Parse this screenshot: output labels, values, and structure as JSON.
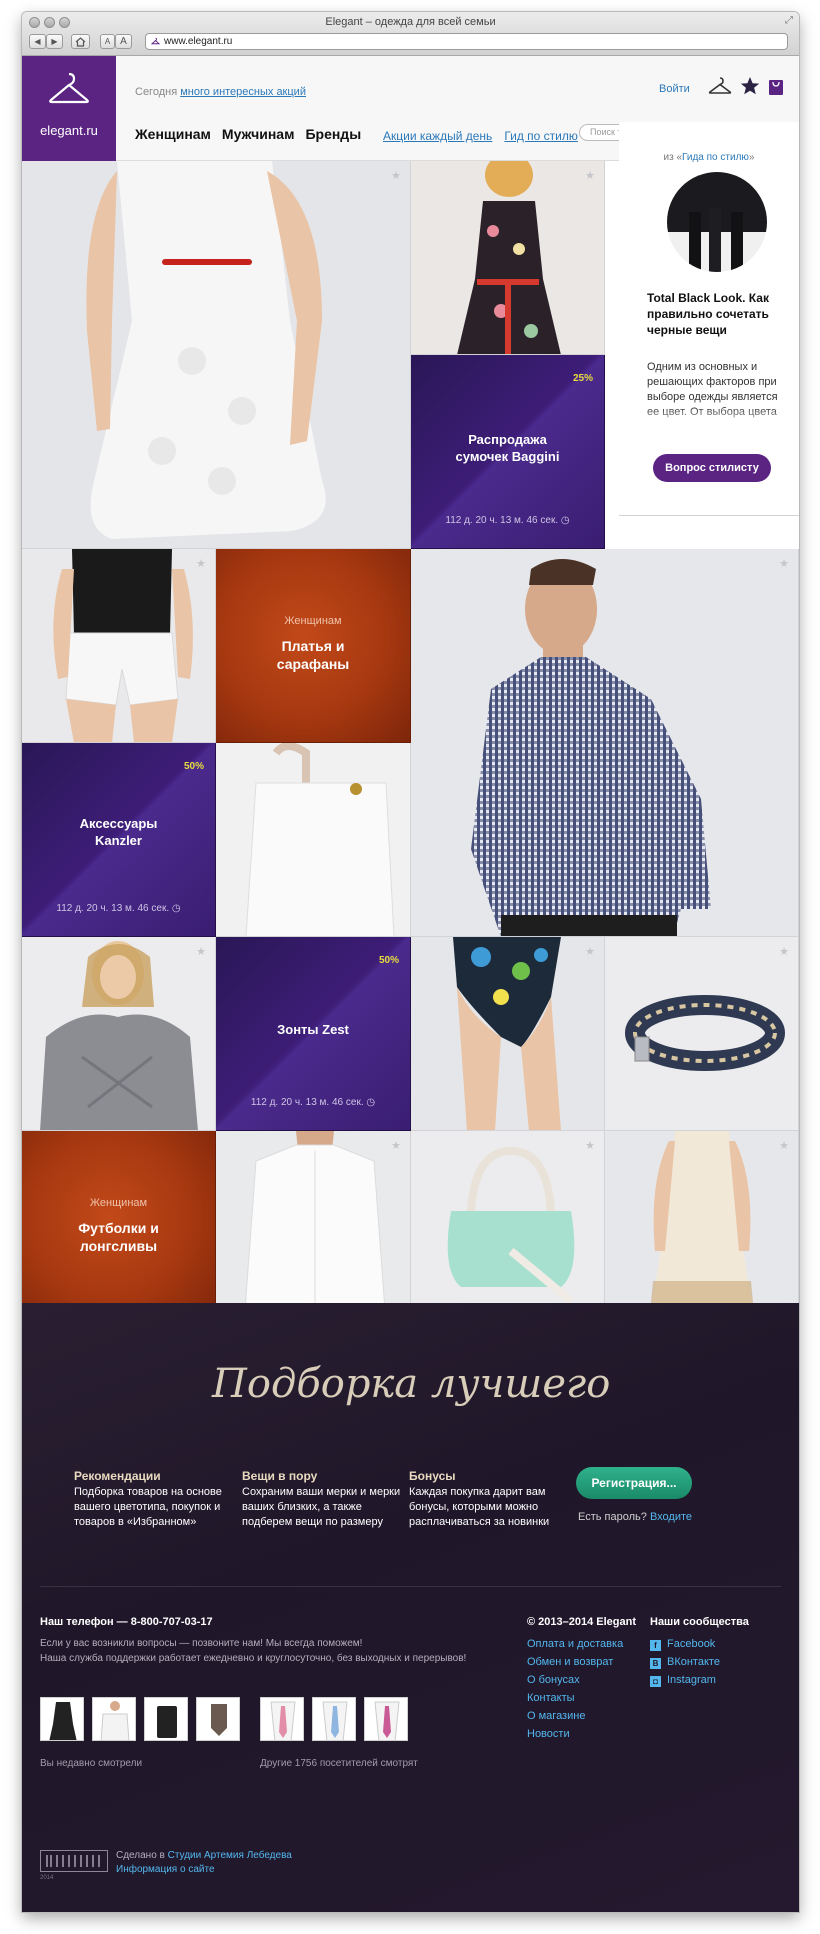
{
  "window": {
    "title": "Elegant – одежда для всей семьи",
    "url": "www.elegant.ru"
  },
  "browser": {
    "back_label": "◀",
    "forward_label": "▶",
    "font_small": "A",
    "font_large": "A"
  },
  "header": {
    "logo_text": "elegant.ru",
    "promo_prefix": "Сегодня ",
    "promo_link": "много интересных акций",
    "login": "Войти",
    "nav": [
      "Женщинам",
      "Мужчинам",
      "Бренды"
    ],
    "subnav": [
      "Акции каждый день",
      "Гид по стилю"
    ],
    "search_placeholder": "Поиск товаров"
  },
  "promos": [
    {
      "title": "Распродажа сумочек Baggini",
      "discount": "25%",
      "timer": "112 д. 20 ч. 13 м. 46 сек."
    },
    {
      "title": "Аксессуары Kanzler",
      "discount": "50%",
      "timer": "112 д. 20 ч. 13 м. 46 сек."
    },
    {
      "title": "Зонты Zest",
      "discount": "50%",
      "timer": "112 д. 20 ч. 13 м. 46 сек."
    }
  ],
  "categories": [
    {
      "subtitle": "Женщинам",
      "title": "Платья и сарафаны"
    },
    {
      "subtitle": "Женщинам",
      "title": "Футболки и лонгсливы"
    }
  ],
  "guide": {
    "from_prefix": "из «",
    "from_link": "Гида по стилю",
    "from_suffix": "»",
    "title": "Total Black Look. Как правильно сочетать черные вещи",
    "text": "Одним из основных и решающих факторов при выборе одежды является ее цвет. От выбора цвета",
    "button": "Вопрос стилисту"
  },
  "footer": {
    "script_title": "Подборка лучшего",
    "features": [
      {
        "head": "Рекомендации",
        "text": "Подборка товаров на основе вашего цветотипа, покупок и товаров в «Избранном»"
      },
      {
        "head": "Вещи в пору",
        "text": "Сохраним ваши мерки и мерки ваших близких, а также подберем вещи по размеру"
      },
      {
        "head": "Бонусы",
        "text": "Каждая покупка дарит вам бонусы, которыми можно расплачиваться за новинки"
      }
    ],
    "register_button": "Регистрация...",
    "password_prefix": "Есть пароль? ",
    "password_link": "Входите",
    "phone": "Наш телефон — 8-800-707-03-17",
    "support_1": "Если у вас возникли вопросы — позвоните нам! Мы всегда поможем!",
    "support_2": "Наша служба поддержки работает ежедневно и круглосуточно, без выходных и перерывов!",
    "recent_caption": "Вы недавно смотрели",
    "others_caption": "Другие 1756 посетителей смотрят",
    "copyright": "© 2013–2014 Elegant",
    "links": [
      "Оплата и доставка",
      "Обмен и возврат",
      "О бонусах",
      "Контакты",
      "О магазине",
      "Новости"
    ],
    "communities_head": "Наши сообщества",
    "socials": [
      {
        "icon": "f",
        "label": "Facebook"
      },
      {
        "icon": "В",
        "label": "ВКонтакте"
      },
      {
        "icon": "◘",
        "label": "Instagram"
      }
    ],
    "made_prefix": "Сделано в ",
    "made_link": "Студии Артемия Лебедева",
    "info_link": "Информация о сайте",
    "studio_year": "2014"
  },
  "colors": {
    "brand_purple": "#5b2483",
    "link_blue": "#2b79b8",
    "promo_yellow": "#e7dd3c",
    "category_orange": "#b0400f",
    "footer_bg": "#221a2c",
    "register_green": "#25a07c"
  }
}
